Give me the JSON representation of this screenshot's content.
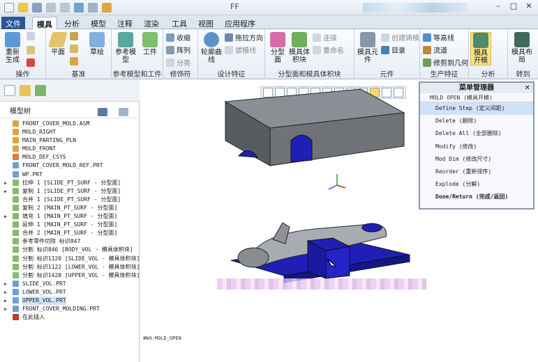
{
  "window": {
    "title": "FF",
    "quick_access_icons": [
      "new-icon",
      "open-icon",
      "save-icon",
      "undo-icon",
      "redo-icon",
      "regenerate-icon",
      "window-icon",
      "close-window-icon"
    ]
  },
  "tabs": [
    "文件",
    "模具",
    "分析",
    "模型",
    "注释",
    "渲染",
    "工具",
    "视图",
    "应用程序"
  ],
  "active_tab": "模具",
  "ribbon": {
    "groups": [
      {
        "label": "操作",
        "items": [
          "重新生成",
          "复制",
          "粘贴",
          "删除"
        ]
      },
      {
        "label": "基准",
        "items": [
          "平面",
          "轴",
          "点",
          "坐标系",
          "草绘"
        ]
      },
      {
        "label": "参考模型和工件",
        "items": [
          "参考模型",
          "工件"
        ]
      },
      {
        "label": "修饰符",
        "items": [
          "收缩",
          "阵列",
          "分类"
        ]
      },
      {
        "label": "设计特征",
        "items": [
          "轮廓曲线",
          "拖拉方向",
          "拔模线"
        ]
      },
      {
        "label": "分型面和模具体积块",
        "items": [
          "分型面",
          "模具体积块",
          "连接",
          "重命名"
        ]
      },
      {
        "label": "元件",
        "items": [
          "模具元件",
          "创建铸模",
          "目录"
        ]
      },
      {
        "label": "生产特征",
        "items": [
          "等高线",
          "流道",
          "修剪到几何"
        ]
      },
      {
        "label": "分析",
        "items": [
          "模具开模"
        ]
      },
      {
        "label": "转到",
        "items": [
          "模具布局"
        ]
      }
    ]
  },
  "model_tree": {
    "title": "模型树",
    "nodes": [
      {
        "text": "FRONT_COVER_MOLD.ASM",
        "expand": false
      },
      {
        "text": "MOLD_RIGHT",
        "expand": false
      },
      {
        "text": "MAIN_PARTING_PLN",
        "expand": false
      },
      {
        "text": "MOLD_FRONT",
        "expand": false
      },
      {
        "text": "MOLD_DEF_CSYS",
        "expand": false
      },
      {
        "text": "FRONT_COVER_MOLD_REF.PRT",
        "expand": false
      },
      {
        "text": "WP.PRT",
        "expand": false
      },
      {
        "text": "拉伸 1 [SLIDE_PT_SURF - 分型面]",
        "expand": true
      },
      {
        "text": "复制 1 [SLIDE_PT_SURF - 分型面]",
        "expand": true
      },
      {
        "text": "合并 1 [SLIDE_PT_SURF - 分型面]",
        "expand": false
      },
      {
        "text": "复制 2 [MAIN_PT_SURF - 分型面]",
        "expand": false
      },
      {
        "text": "填充 1 [MAIN_PT_SURF - 分型面]",
        "expand": true
      },
      {
        "text": "延伸 1 [MAIN_PT_SURF - 分型面]",
        "expand": false
      },
      {
        "text": "合并 2 [MAIN_PT_SURF - 分型面]",
        "expand": false
      },
      {
        "text": "参考零件切除 标识847",
        "expand": false
      },
      {
        "text": "分割 标识846 [BODY_VOL - 模具体积块]",
        "expand": false
      },
      {
        "text": "分割 标识1120 [SLIDE_VOL - 模具体积块]",
        "expand": false
      },
      {
        "text": "分割 标识1122 [LOWER_VOL - 模具体积块]",
        "expand": false
      },
      {
        "text": "分割 标识1428 [UPPER_VOL - 模具体积块]",
        "expand": false
      },
      {
        "text": "SLIDE_VOL.PRT",
        "expand": true
      },
      {
        "text": "LOWER_VOL.PRT",
        "expand": true
      },
      {
        "text": "UPPER_VOL.PRT",
        "expand": true
      },
      {
        "text": "FRONT_COVER_MOLDING.PRT",
        "expand": true
      },
      {
        "text": "在此插入",
        "expand": false
      }
    ]
  },
  "menu_manager": {
    "title": "菜单管理器",
    "subtitle": "MOLD OPEN (模具开模)",
    "items": [
      "Define Step (定义间距)",
      "Delete (删除)",
      "Delete All (全部删除)",
      "Modify (修改)",
      "Mod Dim (修改尺寸)",
      "Reorder (重新排序)",
      "Explode (分解)",
      "Done/Return (完成/返回)"
    ]
  },
  "viewport": {
    "label": "#W4:MOLD_OPEN"
  },
  "colors": {
    "mold_gray": "#6f7378",
    "volume_blue": "#1f1fb8",
    "ribbon_bg": "#e6edf5",
    "file_tab": "#2b5797"
  }
}
